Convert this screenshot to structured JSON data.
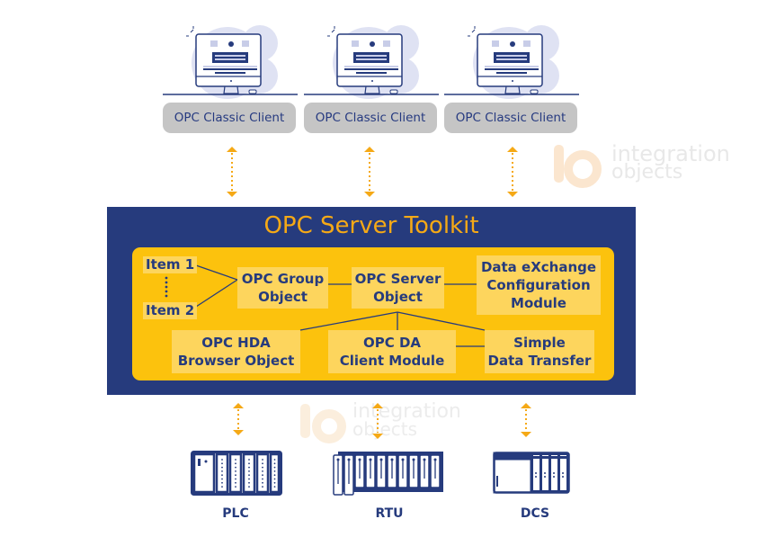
{
  "clients": [
    {
      "label": "OPC Classic Client",
      "icon": "desktop-computer-icon"
    },
    {
      "label": "OPC Classic Client",
      "icon": "desktop-computer-icon"
    },
    {
      "label": "OPC Classic Client",
      "icon": "desktop-computer-icon"
    }
  ],
  "toolkit": {
    "title": "OPC Server Toolkit",
    "items": {
      "item1": "Item 1",
      "ellipsis": "⋮",
      "item2": "Item 2"
    },
    "boxes": {
      "group_object": [
        "OPC Group",
        "Object"
      ],
      "server_object": [
        "OPC Server",
        "Object"
      ],
      "dx_config": [
        "Data eXchange",
        "Configuration",
        "Module"
      ],
      "hda_browser": [
        "OPC HDA",
        "Browser Object"
      ],
      "da_client": [
        "OPC DA",
        "Client Module"
      ],
      "simple_transfer": [
        "Simple",
        "Data Transfer"
      ]
    }
  },
  "devices": [
    {
      "label": "PLC",
      "icon": "plc-icon"
    },
    {
      "label": "RTU",
      "icon": "rtu-icon"
    },
    {
      "label": "DCS",
      "icon": "dcs-icon"
    }
  ],
  "watermark": {
    "line1": "integration",
    "line2": "objects",
    "logo": "io"
  },
  "colors": {
    "navy": "#263b7d",
    "orange": "#f5a916",
    "yellow": "#fcc20d",
    "box": "#fdd55d",
    "client_label_bg": "#c5c5c5",
    "blob": "#dfe2f3"
  }
}
